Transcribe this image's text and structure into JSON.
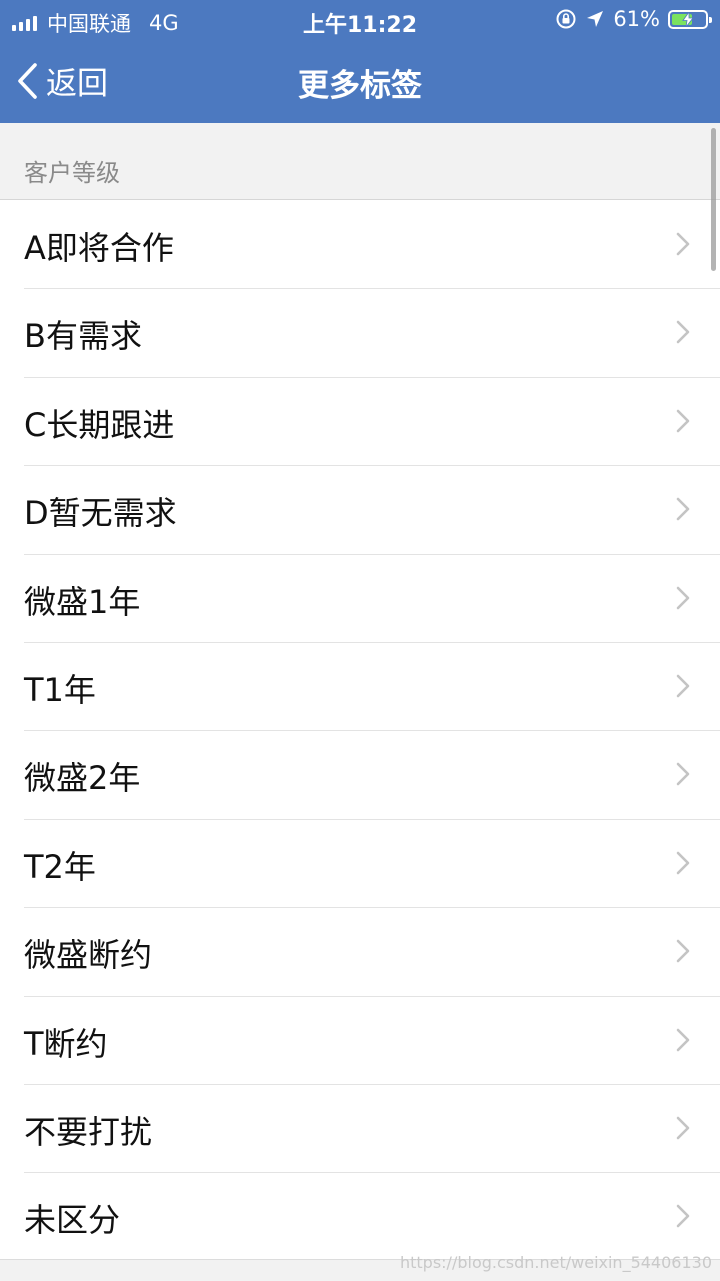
{
  "status_bar": {
    "carrier": "中国联通",
    "network": "4G",
    "time": "上午11:22",
    "battery_percent": "61%",
    "battery_level": 0.61,
    "icons": [
      "signal-icon",
      "orientation-lock-icon",
      "location-arrow-icon",
      "battery-charging-icon"
    ]
  },
  "nav": {
    "back_label": "返回",
    "title": "更多标签"
  },
  "section": {
    "label": "客户等级"
  },
  "items": [
    {
      "label": "A即将合作"
    },
    {
      "label": "B有需求"
    },
    {
      "label": "C长期跟进"
    },
    {
      "label": "D暂无需求"
    },
    {
      "label": "微盛1年"
    },
    {
      "label": "T1年"
    },
    {
      "label": "微盛2年"
    },
    {
      "label": "T2年"
    },
    {
      "label": "微盛断约"
    },
    {
      "label": "T断约"
    },
    {
      "label": "不要打扰"
    },
    {
      "label": "未区分"
    }
  ],
  "watermark": "https://blog.csdn.net/weixin_54406130",
  "colors": {
    "header_bg": "#4c79c0",
    "section_bg": "#f2f2f2",
    "battery_fill": "#7be35f"
  }
}
